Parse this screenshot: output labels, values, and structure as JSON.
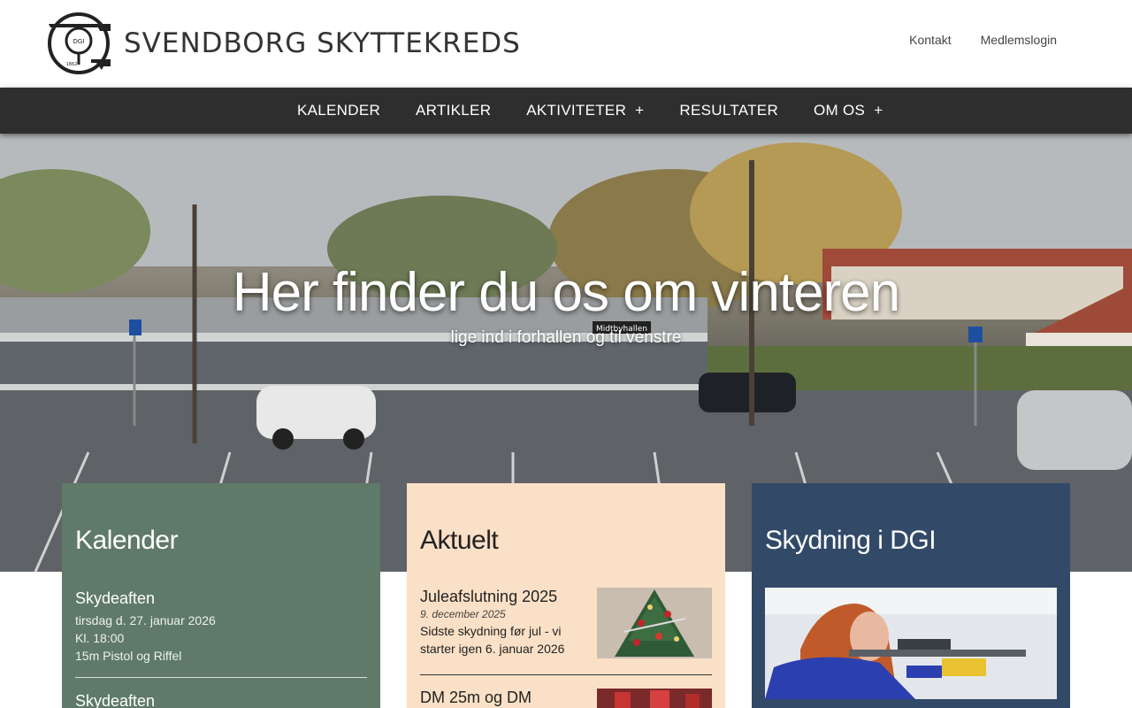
{
  "header": {
    "site_title": "SVENDBORG SKYTTEKREDS",
    "logo_text": "DGI",
    "logo_year": "1862",
    "links": {
      "contact": "Kontakt",
      "member_login": "Medlemslogin"
    }
  },
  "nav": {
    "items": [
      {
        "label": "KALENDER",
        "has_submenu": false
      },
      {
        "label": "ARTIKLER",
        "has_submenu": false
      },
      {
        "label": "AKTIVITETER",
        "has_submenu": true
      },
      {
        "label": "RESULTATER",
        "has_submenu": false
      },
      {
        "label": "OM OS",
        "has_submenu": true
      }
    ],
    "submenu_icon": "+"
  },
  "hero": {
    "title": "Her finder du os om vinteren",
    "subtitle": "lige ind i forhallen og til venstre",
    "building_sign": "Midtbyhallen"
  },
  "calendar": {
    "heading": "Kalender",
    "events": [
      {
        "title": "Skydeaften",
        "date": "tirsdag d. 27. januar 2026",
        "time": "Kl. 18:00",
        "desc": "15m Pistol og Riffel"
      },
      {
        "title": "Skydeaften"
      }
    ]
  },
  "news": {
    "heading": "Aktuelt",
    "items": [
      {
        "title": "Juleafslutning 2025",
        "date": "9. december 2025",
        "text": "Sidste skydning før jul - vi starter igen 6. januar 2026"
      },
      {
        "title": "DM 25m og DM"
      }
    ]
  },
  "dgi": {
    "heading": "Skydning i DGI"
  },
  "colors": {
    "nav_bg": "#2e2e2e",
    "card_green": "#5f7a68",
    "card_peach": "#fae0c6",
    "card_blue": "#324a68"
  }
}
